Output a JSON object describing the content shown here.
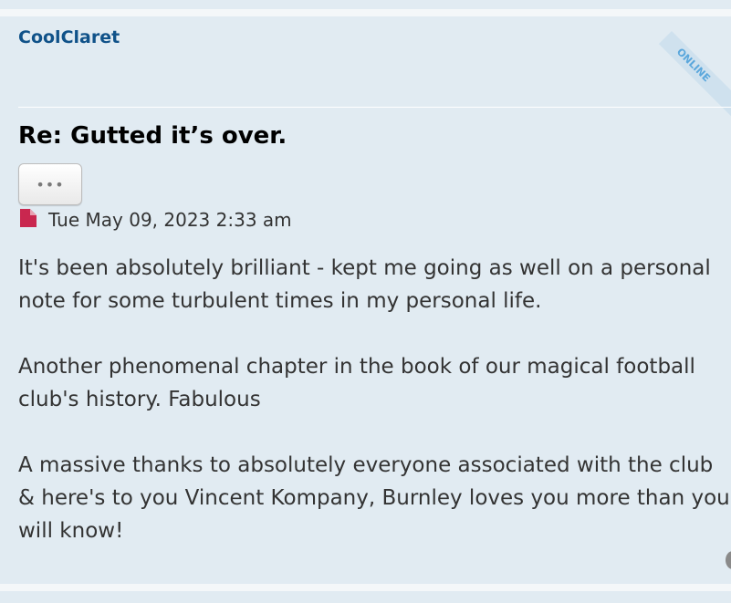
{
  "post": {
    "username": "CoolClaret",
    "online_label": "ONLINE",
    "title": "Re: Gutted it’s over.",
    "more_button_label": "•••",
    "date": "Tue May 09, 2023 2:33 am",
    "body": [
      "It's been absolutely brilliant - kept me going as well on a personal note for some turbulent times in my personal life.",
      "Another phenomenal chapter in the book of our magical football club's history. Fabulous",
      "A massive thanks to absolutely everyone associated with the club & here's to you Vincent Kompany, Burnley loves you more than you will know!"
    ],
    "icons": {
      "post": "file-icon",
      "more": "ellipsis-icon"
    }
  },
  "colors": {
    "post_background": "#e1ebf2",
    "username": "#105289",
    "post_icon": "#c9274f",
    "online_ribbon": "#5aa7dc"
  }
}
